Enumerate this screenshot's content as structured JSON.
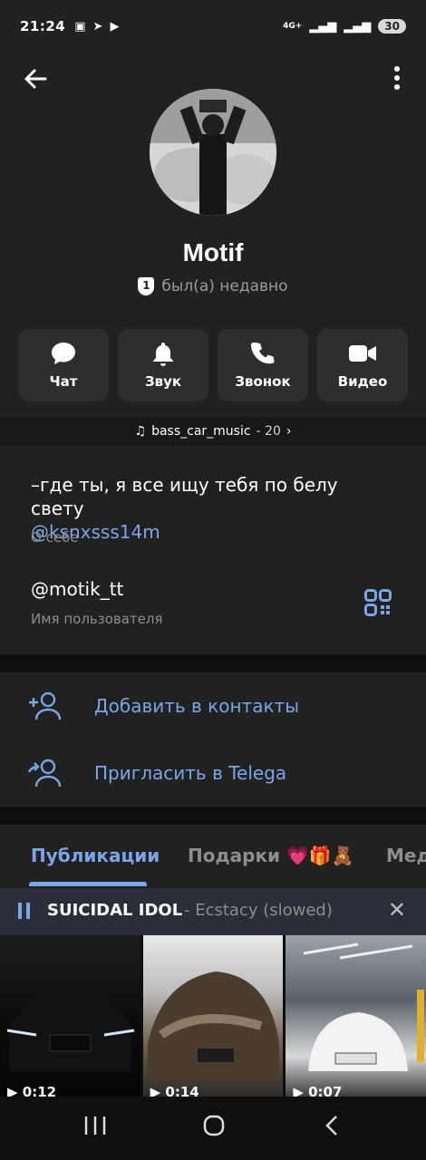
{
  "status_bar": {
    "time": "21:24",
    "battery": "30",
    "network": "4G+"
  },
  "profile": {
    "name": "Motif",
    "last_seen": "был(а) недавно",
    "badge_number": "1"
  },
  "actions": [
    {
      "label": "Чат",
      "icon": "chat-bubble-icon"
    },
    {
      "label": "Звук",
      "icon": "bell-icon"
    },
    {
      "label": "Звонок",
      "icon": "phone-icon"
    },
    {
      "label": "Видео",
      "icon": "video-camera-icon"
    }
  ],
  "music": {
    "channel": "bass_car_music",
    "count": "- 20",
    "icon": "music-note-icon"
  },
  "info": {
    "bio_line": "–где ты, я все ищу тебя по белу свету",
    "bio_mention": "@ksnxsss14m",
    "bio_label": "О себе",
    "username": "@motik_tt",
    "username_label": "Имя пользователя"
  },
  "contacts": {
    "add": "Добавить в контакты",
    "invite": "Пригласить в Telega"
  },
  "tabs": {
    "publications": "Публикации",
    "gifts": "Подарки 💗🎁🧸",
    "media": "Мед"
  },
  "player": {
    "title": "SUICIDAL IDOL",
    "artist": "- Ecstacy (slowed)"
  },
  "videos": [
    {
      "duration": "▶ 0:12"
    },
    {
      "duration": "▶ 0:14"
    },
    {
      "duration": "▶ 0:07"
    }
  ],
  "colors": {
    "accent": "#7aa6e8",
    "panel": "#212121",
    "background": "#0f0f0f"
  }
}
